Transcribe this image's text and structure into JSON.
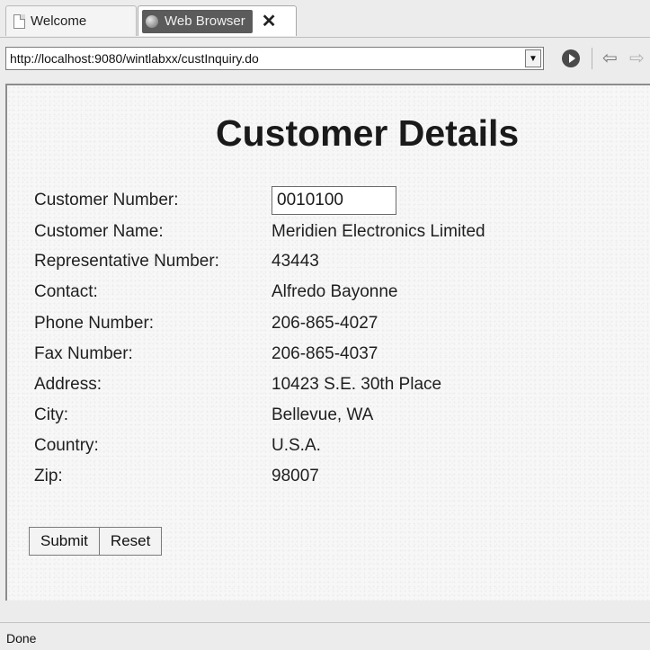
{
  "tabs": [
    {
      "label": "Welcome",
      "icon": "page-icon",
      "active": false
    },
    {
      "label": "Web Browser",
      "icon": "globe-icon",
      "active": true
    }
  ],
  "address": {
    "url": "http://localhost:9080/wintlabxx/custInquiry.do"
  },
  "page": {
    "title": "Customer Details",
    "fields": [
      {
        "label": "Customer Number:",
        "value": "0010100",
        "editable": true
      },
      {
        "label": "Customer Name:",
        "value": "Meridien Electronics Limited"
      },
      {
        "label": "Representative Number:",
        "value": "43443"
      },
      {
        "label": "Contact:",
        "value": "Alfredo Bayonne"
      },
      {
        "label": "Phone Number:",
        "value": "206-865-4027"
      },
      {
        "label": "Fax Number:",
        "value": "206-865-4037"
      },
      {
        "label": "Address:",
        "value": "10423 S.E. 30th Place"
      },
      {
        "label": "City:",
        "value": "Bellevue, WA"
      },
      {
        "label": "Country:",
        "value": "U.S.A."
      },
      {
        "label": "Zip:",
        "value": "98007"
      }
    ],
    "buttons": {
      "submit": "Submit",
      "reset": "Reset"
    }
  },
  "status": {
    "text": "Done"
  }
}
